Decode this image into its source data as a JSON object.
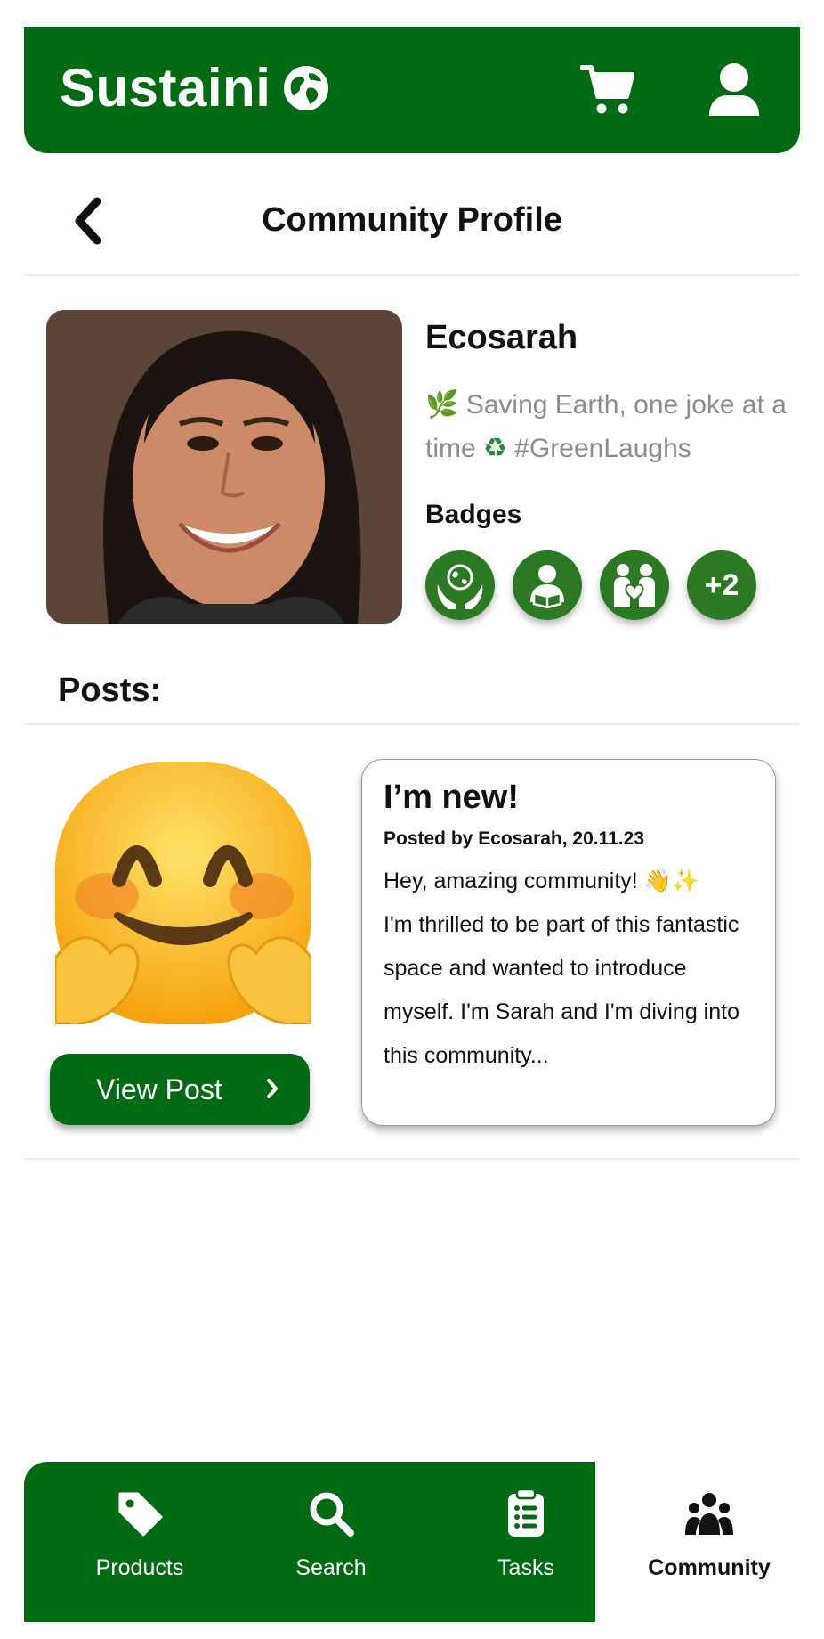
{
  "header": {
    "brand": "Sustaini"
  },
  "page": {
    "title": "Community Profile"
  },
  "profile": {
    "username": "Ecosarah",
    "bio_part1": "Saving Earth, one joke at a time",
    "bio_hashtag": "#GreenLaughs",
    "badges_label": "Badges",
    "more_badges": "+2"
  },
  "posts": {
    "label": "Posts:",
    "items": [
      {
        "title": "I’m new!",
        "meta": "Posted by Ecosarah, 20.11.23",
        "greeting": "Hey, amazing community!",
        "body": "I'm thrilled to be part of this fantastic space and wanted to introduce myself. I'm Sarah and I'm diving into this community...",
        "view_label": "View Post"
      }
    ]
  },
  "nav": {
    "items": [
      {
        "label": "Products",
        "icon": "tag-icon"
      },
      {
        "label": "Search",
        "icon": "search-icon"
      },
      {
        "label": "Tasks",
        "icon": "clipboard-icon"
      },
      {
        "label": "Community",
        "icon": "community-icon",
        "active": true
      }
    ]
  },
  "colors": {
    "brand_green": "#026a13",
    "badge_green": "#2b7a23",
    "muted_text": "#8c8c8c"
  }
}
